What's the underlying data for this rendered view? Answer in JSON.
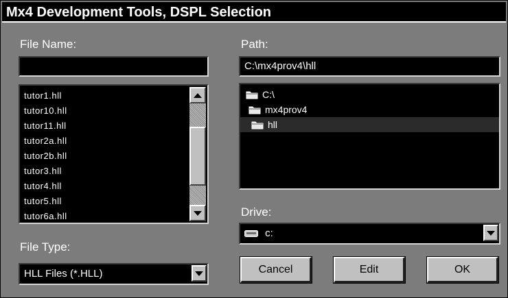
{
  "window": {
    "title": "Mx4 Development Tools, DSPL Selection"
  },
  "file_name": {
    "label": "File Name:",
    "value": ""
  },
  "path": {
    "label": "Path:",
    "value": "C:\\mx4prov4\\hll"
  },
  "files": [
    "tutor1.hll",
    "tutor10.hll",
    "tutor11.hll",
    "tutor2a.hll",
    "tutor2b.hll",
    "tutor3.hll",
    "tutor4.hll",
    "tutor5.hll",
    "tutor6a.hll"
  ],
  "directories": [
    {
      "name": "C:\\",
      "icon": "folder-open-icon"
    },
    {
      "name": "mx4prov4",
      "icon": "folder-open-icon"
    },
    {
      "name": "hll",
      "icon": "folder-open-icon",
      "selected": true
    }
  ],
  "file_type": {
    "label": "File Type:",
    "value": "HLL Files (*.HLL)"
  },
  "drive": {
    "label": "Drive:",
    "value": "c:",
    "icon": "drive-icon"
  },
  "buttons": {
    "cancel": "Cancel",
    "edit": "Edit",
    "ok": "OK"
  }
}
